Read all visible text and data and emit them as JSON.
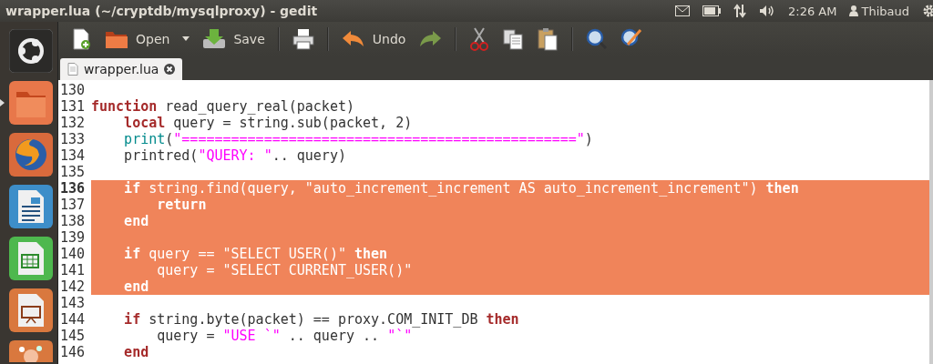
{
  "window": {
    "title": "wrapper.lua (~/cryptdb/mysqlproxy) - gedit"
  },
  "panel": {
    "indicators": [
      {
        "kind": "mail"
      },
      {
        "kind": "battery"
      },
      {
        "kind": "network"
      },
      {
        "kind": "volume"
      }
    ],
    "clock": "2:26 AM",
    "user": "Thibaud"
  },
  "launcher": [
    {
      "kind": "dash",
      "running": false
    },
    {
      "kind": "files",
      "running": true
    },
    {
      "kind": "browser",
      "running": false
    },
    {
      "kind": "writer",
      "running": false
    },
    {
      "kind": "calc",
      "running": false
    },
    {
      "kind": "impress",
      "running": false
    },
    {
      "kind": "software",
      "running": false
    }
  ],
  "toolbar": [
    {
      "kind": "new"
    },
    {
      "kind": "open",
      "label": "Open"
    },
    {
      "kind": "dropdown"
    },
    {
      "kind": "save",
      "label": "Save"
    },
    {
      "kind": "separator"
    },
    {
      "kind": "print"
    },
    {
      "kind": "separator"
    },
    {
      "kind": "undo",
      "label": "Undo"
    },
    {
      "kind": "redo",
      "disabled": false
    },
    {
      "kind": "separator"
    },
    {
      "kind": "cut"
    },
    {
      "kind": "copy"
    },
    {
      "kind": "paste"
    },
    {
      "kind": "separator"
    },
    {
      "kind": "find"
    },
    {
      "kind": "replace"
    }
  ],
  "tabs": [
    {
      "label": "wrapper.lua",
      "selected": true
    }
  ],
  "editor": {
    "lines": [
      {
        "number": "130",
        "selected": false,
        "current": false
      },
      {
        "number": "131",
        "selected": false,
        "current": false,
        "tokens": [
          {
            "kind": "keyword",
            "text": "function"
          },
          {
            "kind": "text",
            "text": " read_query_real(packet)"
          }
        ]
      },
      {
        "number": "132",
        "selected": false,
        "current": false,
        "tokens": [
          {
            "kind": "keyword",
            "text": "    local"
          },
          {
            "kind": "text",
            "text": " query = string.sub(packet, 2)"
          }
        ]
      },
      {
        "number": "133",
        "selected": false,
        "current": false,
        "tokens": [
          {
            "kind": "builtin",
            "text": "    print"
          },
          {
            "kind": "text",
            "text": "("
          },
          {
            "kind": "string",
            "text": "\"================================================\""
          },
          {
            "kind": "text",
            "text": ")"
          }
        ]
      },
      {
        "number": "134",
        "selected": false,
        "current": false,
        "tokens": [
          {
            "kind": "text",
            "text": "    printred("
          },
          {
            "kind": "string",
            "text": "\"QUERY: \""
          },
          {
            "kind": "text",
            "text": ".. query)"
          }
        ]
      },
      {
        "number": "135",
        "selected": false,
        "current": false
      },
      {
        "number": "136",
        "selected": true,
        "current": true,
        "tokens": [
          {
            "kind": "keyword",
            "text": "    if"
          },
          {
            "kind": "text",
            "text": " string.find(query, "
          },
          {
            "kind": "string",
            "text": "\"auto_increment_increment AS auto_increment_increment\""
          },
          {
            "kind": "text",
            "text": ")"
          },
          {
            "kind": "keyword",
            "text": " then"
          }
        ]
      },
      {
        "number": "137",
        "selected": true,
        "current": false,
        "tokens": [
          {
            "kind": "keyword",
            "text": "        return"
          }
        ]
      },
      {
        "number": "138",
        "selected": true,
        "current": false,
        "tokens": [
          {
            "kind": "keyword",
            "text": "    end"
          }
        ]
      },
      {
        "number": "139",
        "selected": true,
        "current": false
      },
      {
        "number": "140",
        "selected": true,
        "current": false,
        "tokens": [
          {
            "kind": "keyword",
            "text": "    if"
          },
          {
            "kind": "text",
            "text": " query == "
          },
          {
            "kind": "string",
            "text": "\"SELECT USER()\""
          },
          {
            "kind": "keyword",
            "text": " then"
          }
        ]
      },
      {
        "number": "141",
        "selected": true,
        "current": false,
        "tokens": [
          {
            "kind": "text",
            "text": "        query = "
          },
          {
            "kind": "string",
            "text": "\"SELECT CURRENT_USER()\""
          }
        ]
      },
      {
        "number": "142",
        "selected": true,
        "current": false,
        "tokens": [
          {
            "kind": "keyword",
            "text": "    end"
          }
        ]
      },
      {
        "number": "143",
        "selected": false,
        "current": false
      },
      {
        "number": "144",
        "selected": false,
        "current": false,
        "tokens": [
          {
            "kind": "keyword",
            "text": "    if"
          },
          {
            "kind": "text",
            "text": " string.byte(packet) == proxy.COM_INIT_DB "
          },
          {
            "kind": "keyword",
            "text": "then"
          }
        ]
      },
      {
        "number": "145",
        "selected": false,
        "current": false,
        "tokens": [
          {
            "kind": "text",
            "text": "        query = "
          },
          {
            "kind": "string",
            "text": "\"USE `\""
          },
          {
            "kind": "text",
            "text": " .. query .. "
          },
          {
            "kind": "string",
            "text": "\"`\""
          }
        ]
      },
      {
        "number": "146",
        "selected": false,
        "current": false,
        "tokens": [
          {
            "kind": "keyword",
            "text": "    end"
          }
        ]
      }
    ]
  }
}
